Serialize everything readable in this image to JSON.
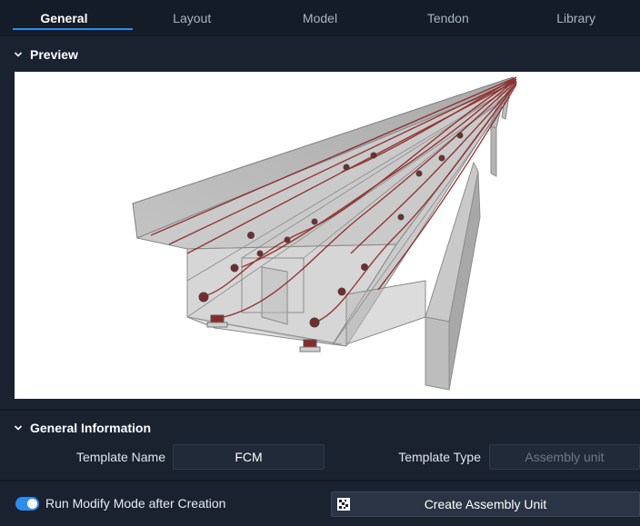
{
  "tabs": [
    {
      "label": "General",
      "active": true
    },
    {
      "label": "Layout",
      "active": false
    },
    {
      "label": "Model",
      "active": false
    },
    {
      "label": "Tendon",
      "active": false
    },
    {
      "label": "Library",
      "active": false
    }
  ],
  "preview": {
    "title": "Preview"
  },
  "general_info": {
    "title": "General Information",
    "template_name_label": "Template Name",
    "template_name_value": "FCM",
    "template_type_label": "Template Type",
    "template_type_value": "Assembly unit"
  },
  "footer": {
    "toggle_label": "Run Modify Mode after Creation",
    "toggle_on": true,
    "create_button_label": "Create Assembly Unit"
  },
  "colors": {
    "accent": "#2d8cf0",
    "background": "#1a2230",
    "tab_bar": "#141c28"
  },
  "icons": {
    "section_toggle": "chevron-down-icon",
    "create": "assembly-icon"
  }
}
